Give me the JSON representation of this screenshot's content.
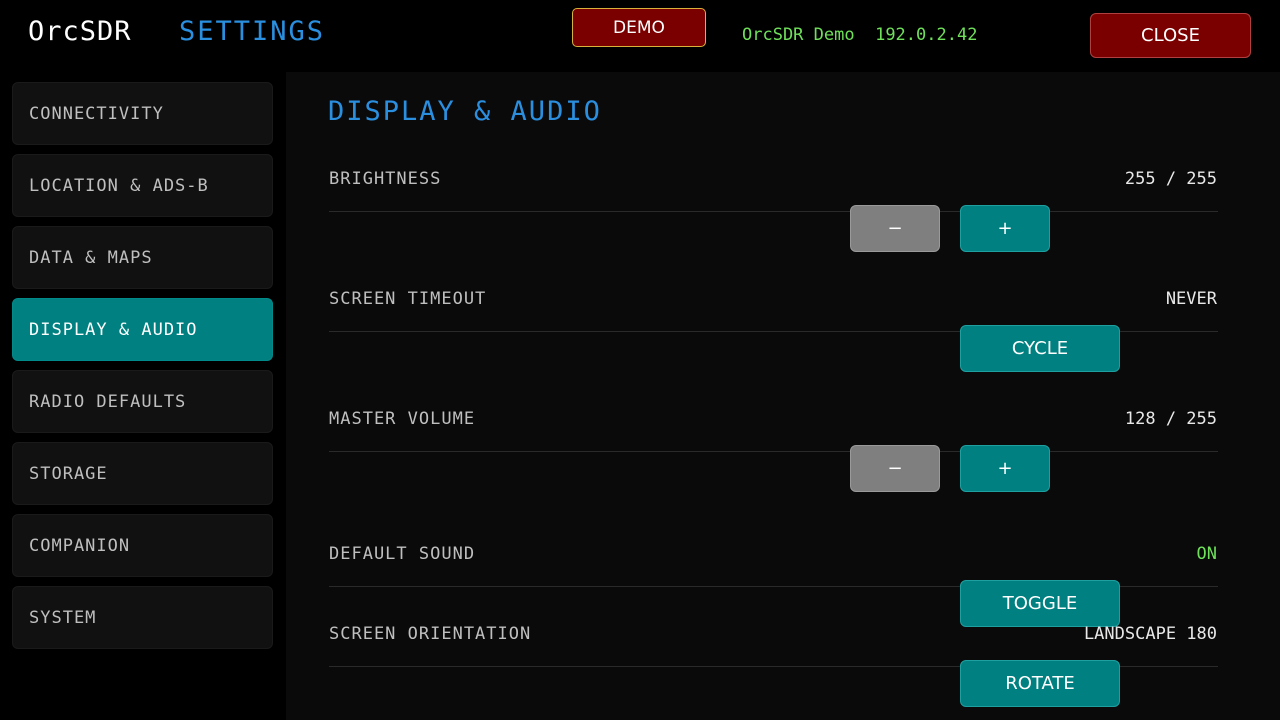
{
  "header": {
    "app_name": "OrcSDR",
    "page_title": "SETTINGS",
    "demo_label": "DEMO",
    "device_name": "OrcSDR Demo",
    "device_ip": "192.0.2.42",
    "close_label": "CLOSE"
  },
  "sidebar": {
    "items": [
      {
        "label": "CONNECTIVITY"
      },
      {
        "label": "LOCATION & ADS-B"
      },
      {
        "label": "DATA & MAPS"
      },
      {
        "label": "DISPLAY & AUDIO"
      },
      {
        "label": "RADIO DEFAULTS"
      },
      {
        "label": "STORAGE"
      },
      {
        "label": "COMPANION"
      },
      {
        "label": "SYSTEM"
      }
    ],
    "active_index": 3
  },
  "main": {
    "section_title": "DISPLAY & AUDIO",
    "brightness": {
      "label": "BRIGHTNESS",
      "value": "255 / 255",
      "minus": "−",
      "plus": "+"
    },
    "screen_timeout": {
      "label": "SCREEN TIMEOUT",
      "value": "NEVER",
      "button": "CYCLE"
    },
    "master_volume": {
      "label": "MASTER VOLUME",
      "value": "128 / 255",
      "minus": "−",
      "plus": "+"
    },
    "default_sound": {
      "label": "DEFAULT SOUND",
      "value": "ON",
      "button": "TOGGLE"
    },
    "screen_orientation": {
      "label": "SCREEN ORIENTATION",
      "value": "LANDSCAPE 180",
      "button": "ROTATE"
    }
  },
  "colors": {
    "accent_teal": "#008080",
    "title_blue": "#2b8fe0",
    "alert_red": "#7a0000",
    "status_green": "#6ee05a"
  }
}
